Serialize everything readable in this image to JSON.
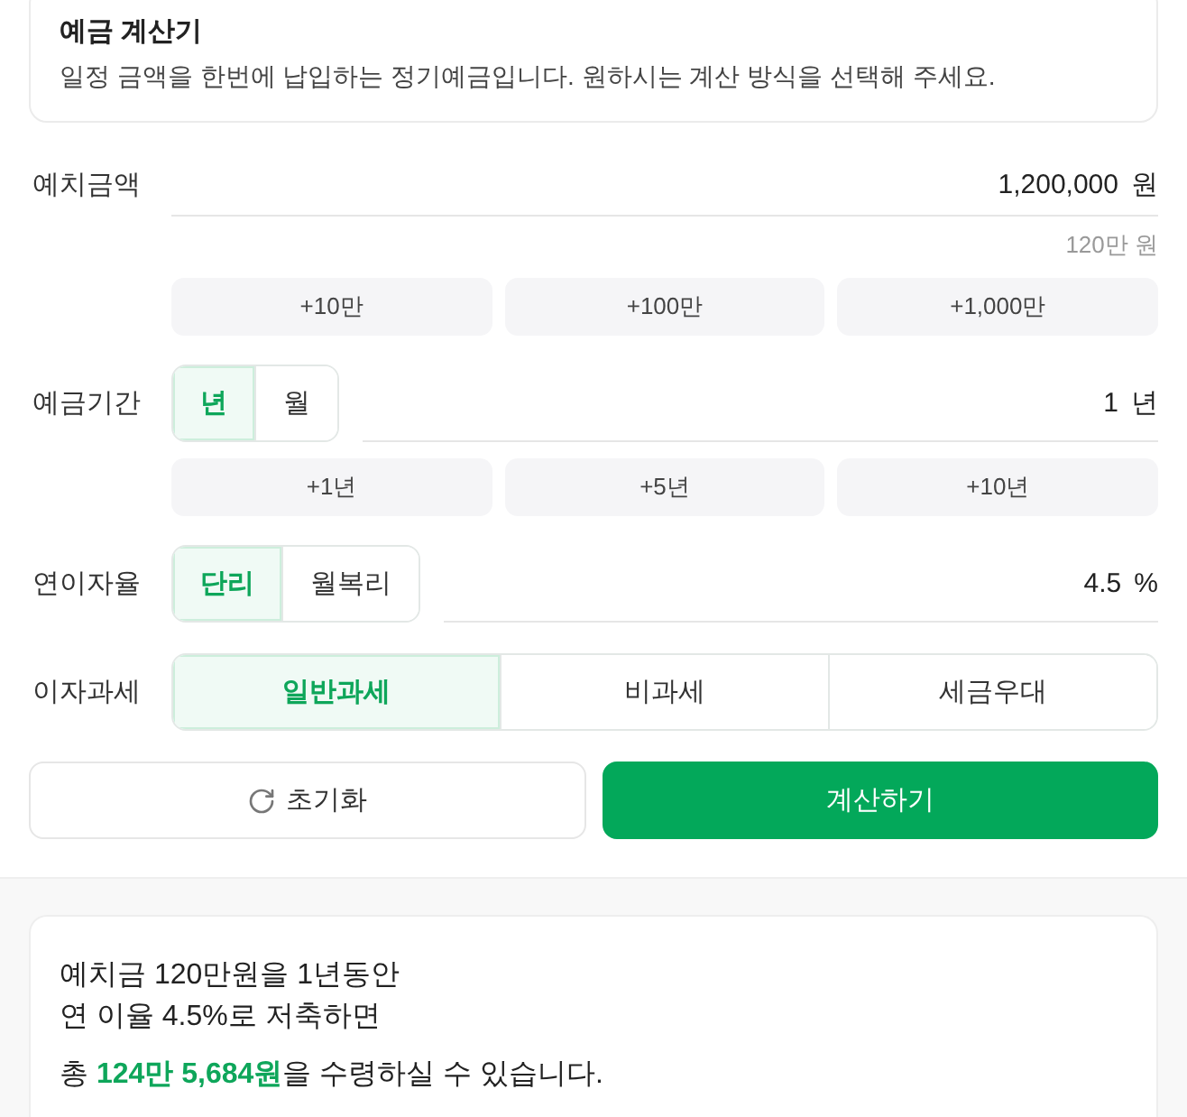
{
  "header": {
    "title": "예금 계산기",
    "description": "일정 금액을 한번에 납입하는 정기예금입니다. 원하시는 계산 방식을 선택해 주세요."
  },
  "fields": [
    {
      "label": "예치금액",
      "input": {
        "value": "1,200,000",
        "unit": "원"
      },
      "hint": "120만 원",
      "presets": [
        "+10만",
        "+100만",
        "+1,000만"
      ]
    },
    {
      "label": "예금기간",
      "toggle": [
        {
          "label": "년",
          "selected": true
        },
        {
          "label": "월",
          "selected": false
        }
      ],
      "input": {
        "value": "1",
        "unit": "년"
      },
      "presets": [
        "+1년",
        "+5년",
        "+10년"
      ]
    },
    {
      "label": "연이자율",
      "toggle": [
        {
          "label": "단리",
          "selected": true
        },
        {
          "label": "월복리",
          "selected": false
        }
      ],
      "input": {
        "value": "4.5",
        "unit": "%"
      }
    },
    {
      "label": "이자과세",
      "options": [
        {
          "label": "일반과세",
          "selected": true
        },
        {
          "label": "비과세",
          "selected": false
        },
        {
          "label": "세금우대",
          "selected": false
        }
      ]
    }
  ],
  "actions": [
    {
      "kind": "reset",
      "label": "초기화"
    },
    {
      "kind": "submit",
      "label": "계산하기"
    }
  ],
  "result": {
    "lines": [
      "예치금 120만원을 1년동안",
      "연 이율 4.5%로 저축하면"
    ],
    "summary": "총 **124만 5,684원**을 수령하실 수 있습니다."
  }
}
